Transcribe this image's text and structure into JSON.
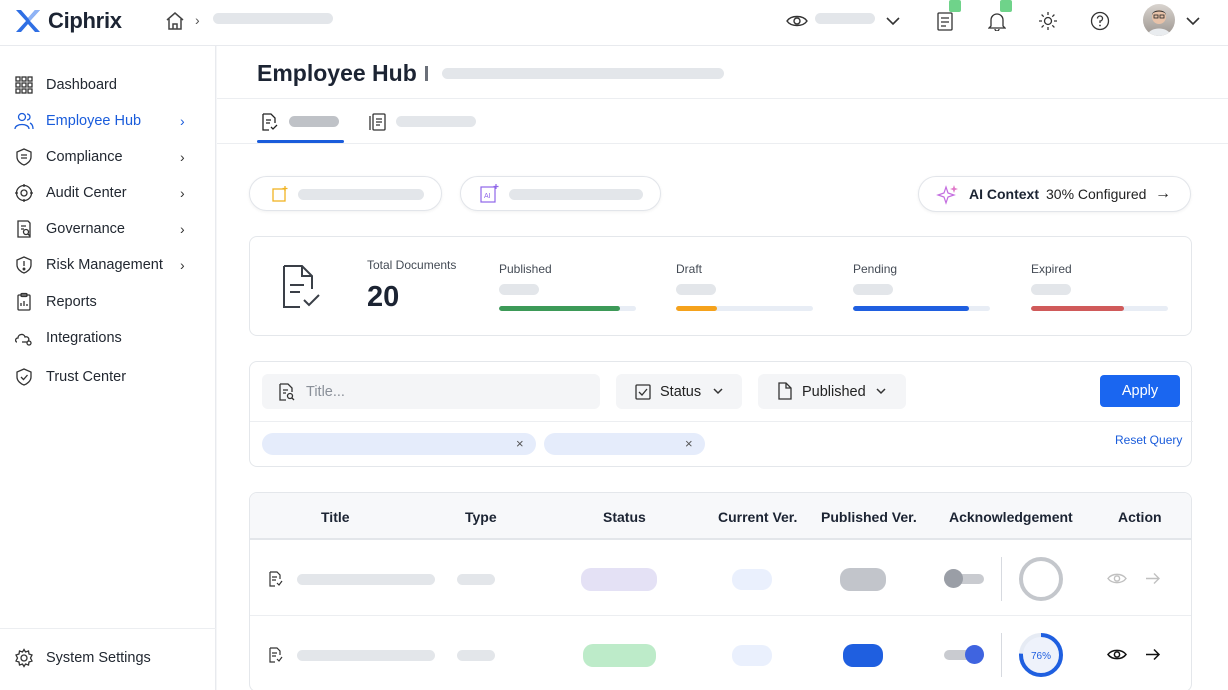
{
  "app": {
    "name": "Ciphrix"
  },
  "header": {
    "icons": [
      "home-icon",
      "eye-icon",
      "chevron-down-icon",
      "checklist-icon",
      "bell-icon",
      "sun-icon",
      "help-icon",
      "avatar",
      "chevron-down-icon"
    ]
  },
  "sidebar": {
    "items": [
      {
        "label": "Dashboard",
        "icon": "grid-icon",
        "has_chevron": false,
        "active": false
      },
      {
        "label": "Employee Hub",
        "icon": "users-icon",
        "has_chevron": true,
        "active": true
      },
      {
        "label": "Compliance",
        "icon": "shield-icon",
        "has_chevron": true,
        "active": false
      },
      {
        "label": "Audit Center",
        "icon": "audit-icon",
        "has_chevron": true,
        "active": false
      },
      {
        "label": "Governance",
        "icon": "governance-icon",
        "has_chevron": true,
        "active": false
      },
      {
        "label": "Risk Management",
        "icon": "risk-icon",
        "has_chevron": true,
        "active": false
      },
      {
        "label": "Reports",
        "icon": "clipboard-icon",
        "has_chevron": false,
        "active": false
      },
      {
        "label": "Integrations",
        "icon": "integrations-icon",
        "has_chevron": false,
        "active": false
      },
      {
        "label": "Trust Center",
        "icon": "trust-icon",
        "has_chevron": false,
        "active": false
      }
    ],
    "footer": {
      "label": "System Settings",
      "icon": "gear-icon"
    }
  },
  "page": {
    "title": "Employee Hub"
  },
  "ai_context": {
    "label": "AI Context",
    "value": "30% Configured",
    "arrow": "→"
  },
  "stats": {
    "total": {
      "label": "Total Documents",
      "value": "20"
    },
    "items": [
      {
        "label": "Published",
        "progress": 0.88,
        "color": "#3d9a58"
      },
      {
        "label": "Draft",
        "progress": 0.3,
        "color": "#f5a21c"
      },
      {
        "label": "Pending",
        "progress": 0.85,
        "color": "#1f5fe0"
      },
      {
        "label": "Expired",
        "progress": 0.68,
        "color": "#d05a5a"
      }
    ]
  },
  "filters": {
    "title_placeholder": "Title...",
    "status_label": "Status",
    "published_label": "Published",
    "apply_label": "Apply",
    "reset_label": "Reset Query",
    "chip_close": "×"
  },
  "table": {
    "columns": [
      "Title",
      "Type",
      "Status",
      "Current Ver.",
      "Published Ver.",
      "Acknowledgement",
      "Action"
    ],
    "rows": [
      {
        "status_color": "#e4e1f5",
        "published_color": "#c2c5cb",
        "toggle_on": false,
        "ack_progress": 0.0,
        "ack_label": "",
        "enabled": false
      },
      {
        "status_color": "#bdebc9",
        "published_color": "#1f5fe0",
        "toggle_on": true,
        "ack_progress": 0.76,
        "ack_label": "76%",
        "enabled": true
      }
    ]
  },
  "colors": {
    "accent": "#1a5cdb",
    "apply": "#1a66f0"
  }
}
